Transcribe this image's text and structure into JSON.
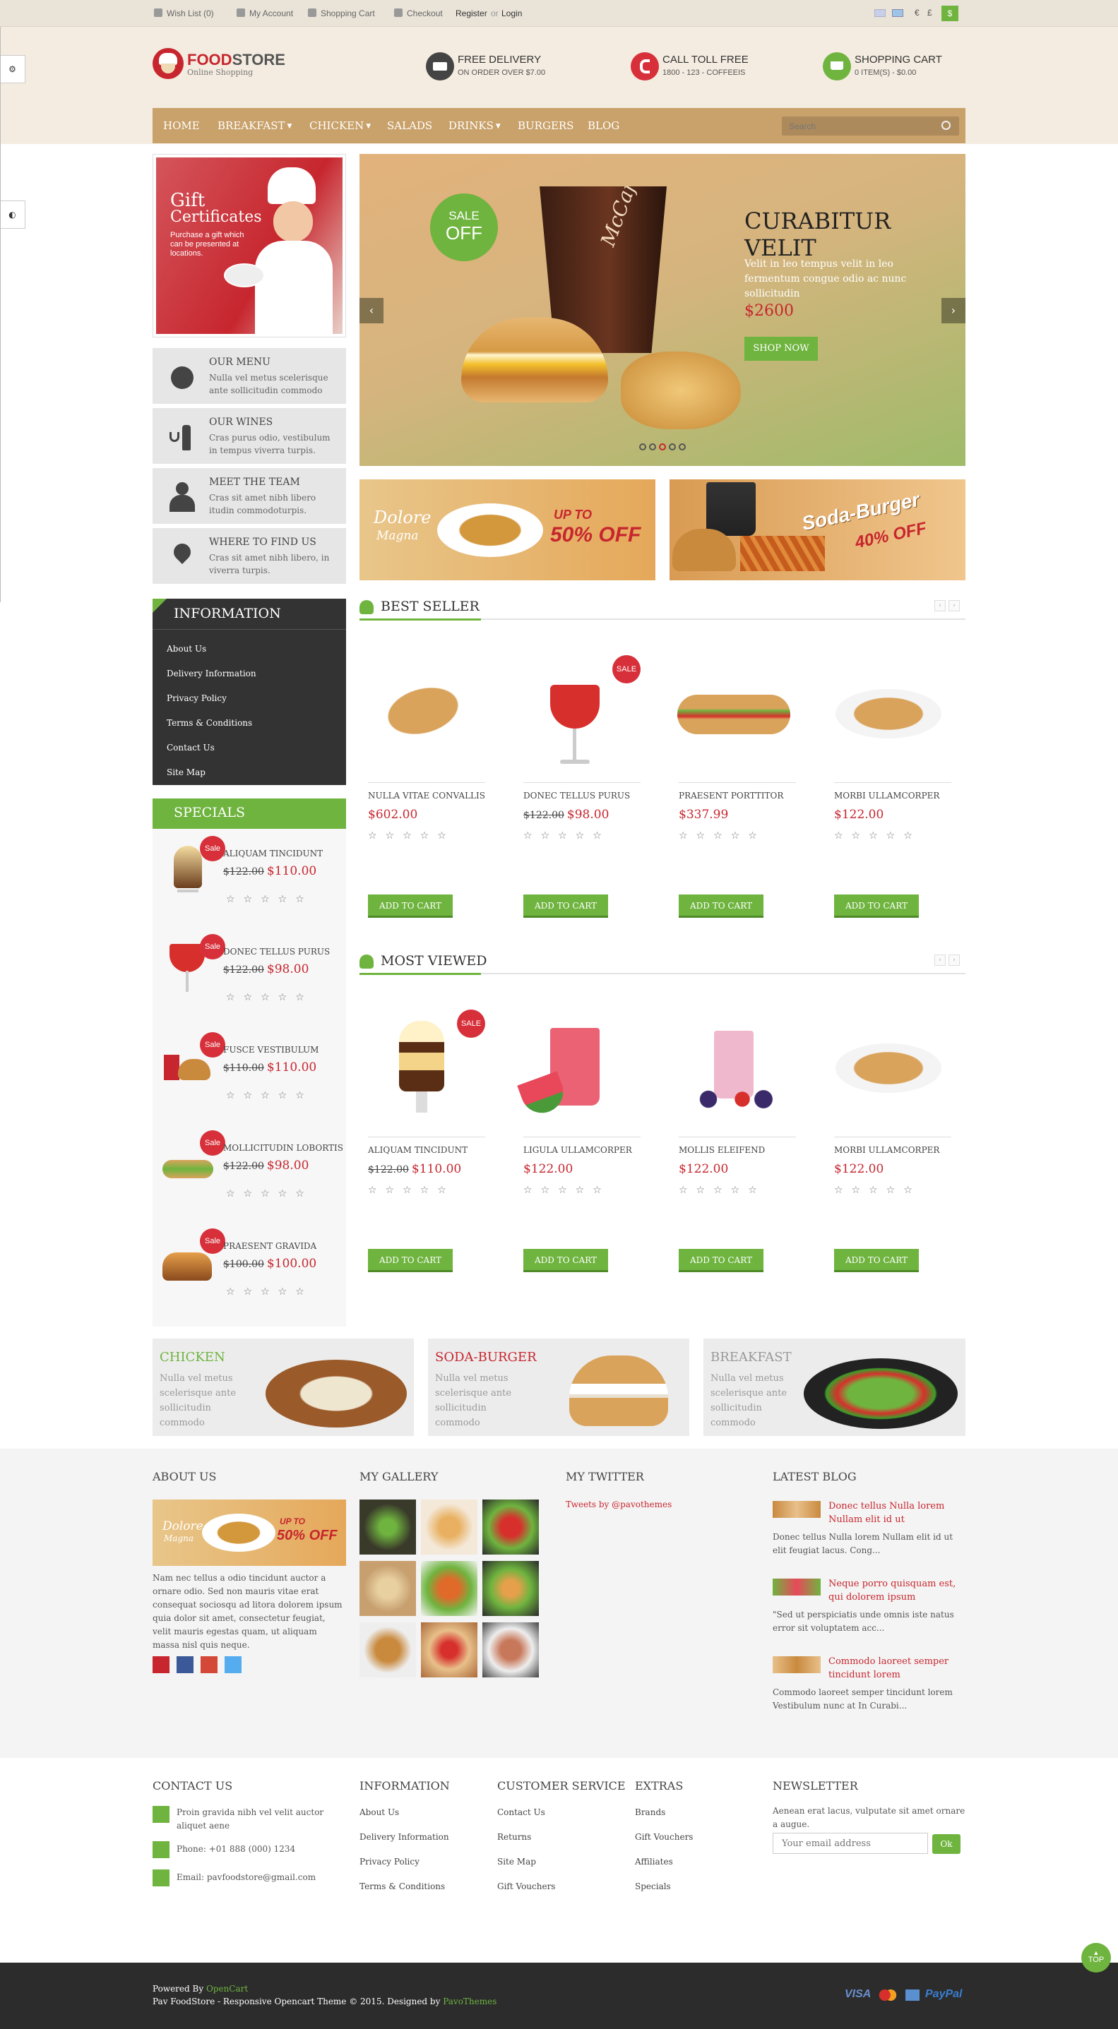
{
  "topbar": {
    "wishlist": "Wish List (0)",
    "account": "My Account",
    "cart": "Shopping Cart",
    "checkout": "Checkout",
    "register": "Register",
    "or": "or",
    "login": "Login",
    "currencies": [
      "€",
      "£",
      "$"
    ]
  },
  "logo": {
    "name_a": "FOOD",
    "name_b": "STORE",
    "tagline": "Online Shopping"
  },
  "header_info": [
    {
      "title": "FREE DELIVERY",
      "sub": "ON ORDER OVER $7.00",
      "icon": "truck-icon",
      "color": "#444444"
    },
    {
      "title": "CALL TOLL FREE",
      "sub": "1800 - 123 - COFFEEIS",
      "icon": "phone-icon",
      "color": "#d7303a"
    },
    {
      "title": "SHOPPING CART",
      "sub": "0 ITEM(S) - $0.00",
      "icon": "cart-icon",
      "color": "#6fb43f"
    }
  ],
  "nav": [
    {
      "label": "HOME",
      "dropdown": false
    },
    {
      "label": "BREAKFAST",
      "dropdown": true
    },
    {
      "label": "CHICKEN",
      "dropdown": true
    },
    {
      "label": "SALADS",
      "dropdown": false
    },
    {
      "label": "DRINKS",
      "dropdown": true
    },
    {
      "label": "BURGERS",
      "dropdown": false
    },
    {
      "label": "BLOG",
      "dropdown": false
    }
  ],
  "search": {
    "placeholder": "Search"
  },
  "gift": {
    "title1": "Gift",
    "title2": "Certificates",
    "desc": "Purchase a gift which can be presented at locations."
  },
  "features": [
    {
      "title": "OUR MENU",
      "desc": "Nulla vel metus scelerisque ante sollicitudin commodo"
    },
    {
      "title": "OUR WINES",
      "desc": "Cras purus odio, vestibulum in tempus viverra turpis."
    },
    {
      "title": "MEET THE TEAM",
      "desc": "Cras sit amet nibh libero itudin commodoturpis."
    },
    {
      "title": "WHERE TO FIND US",
      "desc": "Cras sit amet nibh libero, in viverra turpis."
    }
  ],
  "information": {
    "title": "INFORMATION",
    "links": [
      "About Us",
      "Delivery Information",
      "Privacy Policy",
      "Terms & Conditions",
      "Contact Us",
      "Site Map"
    ]
  },
  "specials": {
    "title": "SPECIALS",
    "sale_label": "Sale",
    "items": [
      {
        "name": "ALIQUAM TINCIDUNT",
        "old": "$122.00",
        "price": "$110.00"
      },
      {
        "name": "DONEC TELLUS PURUS",
        "old": "$122.00",
        "price": "$98.00"
      },
      {
        "name": "FUSCE VESTIBULUM",
        "old": "$110.00",
        "price": "$110.00"
      },
      {
        "name": "MOLLICITUDIN LOBORTIS",
        "old": "$122.00",
        "price": "$98.00"
      },
      {
        "name": "PRAESENT GRAVIDA",
        "old": "$100.00",
        "price": "$100.00"
      }
    ]
  },
  "slider": {
    "badge1": "SALE",
    "badge2": "OFF",
    "title": "CURABITUR VELIT",
    "desc": "Velit in leo tempus velit in leo fermentum congue odio ac nunc sollicitudin",
    "price": "$2600",
    "button": "SHOP NOW",
    "cup_brand": "McCafé",
    "dots": 5,
    "active_dot": 3
  },
  "promo": [
    {
      "name1": "Dolore",
      "name2": "Magna",
      "upto": "UP TO",
      "pct": "50% OFF"
    },
    {
      "name1": "Soda-Burger",
      "pct": "40% OFF"
    }
  ],
  "best_seller": {
    "title": "BEST SELLER",
    "products": [
      {
        "name": "NULLA VITAE CONVALLIS",
        "old": "",
        "price": "$602.00",
        "sale": false
      },
      {
        "name": "DONEC TELLUS PURUS",
        "old": "$122.00",
        "price": "$98.00",
        "sale": true
      },
      {
        "name": "PRAESENT PORTTITOR",
        "old": "",
        "price": "$337.99",
        "sale": false
      },
      {
        "name": "MORBI ULLAMCORPER",
        "old": "",
        "price": "$122.00",
        "sale": false
      }
    ]
  },
  "most_viewed": {
    "title": "MOST VIEWED",
    "products": [
      {
        "name": "ALIQUAM TINCIDUNT",
        "old": "$122.00",
        "price": "$110.00",
        "sale": true
      },
      {
        "name": "LIGULA ULLAMCORPER",
        "old": "",
        "price": "$122.00",
        "sale": false
      },
      {
        "name": "MOLLIS ELEIFEND",
        "old": "",
        "price": "$122.00",
        "sale": false
      },
      {
        "name": "MORBI ULLAMCORPER",
        "old": "",
        "price": "$122.00",
        "sale": false
      }
    ]
  },
  "add_to_cart": "ADD TO CART",
  "sale_label": "SALE",
  "categories": [
    {
      "title": "CHICKEN",
      "desc": "Nulla vel metus scelerisque ante sollicitudin commodo",
      "color": "#6fb43f"
    },
    {
      "title": "SODA-BURGER",
      "desc": "Nulla vel metus scelerisque ante sollicitudin commodo",
      "color": "#c7262e"
    },
    {
      "title": "BREAKFAST",
      "desc": "Nulla vel metus scelerisque ante sollicitudin commodo",
      "color": "#999999"
    }
  ],
  "footer": {
    "about_title": "ABOUT US",
    "about_text": "Nam nec tellus a odio tincidunt auctor a ornare odio. Sed non mauris vitae erat consequat sociosqu ad litora dolorem ipsum quia dolor sit amet, consectetur feugiat, velit mauris egestas quam, ut aliquam massa nisl quis neque.",
    "gallery_title": "MY GALLERY",
    "twitter_title": "MY TWITTER",
    "twitter_link": "Tweets by @pavothemes",
    "blog_title": "LATEST BLOG",
    "blog": [
      {
        "title": "Donec tellus Nulla lorem Nullam elit id ut",
        "desc": "Donec tellus Nulla lorem Nullam elit id ut elit feugiat lacus. Cong..."
      },
      {
        "title": "Neque porro quisquam est, qui dolorem ipsum",
        "desc": "\"Sed ut perspiciatis unde omnis iste natus error sit voluptatem acc..."
      },
      {
        "title": "Commodo laoreet semper tincidunt lorem",
        "desc": "Commodo laoreet semper tincidunt lorem Vestibulum nunc at In Curabi..."
      }
    ],
    "contact_title": "CONTACT US",
    "contact_address": "Proin gravida nibh vel velit auctor aliquet aene",
    "contact_phone": "Phone: +01 888 (000) 1234",
    "contact_email": "Email: pavfoodstore@gmail.com",
    "info_title": "INFORMATION",
    "info_links": [
      "About Us",
      "Delivery Information",
      "Privacy Policy",
      "Terms & Conditions"
    ],
    "cs_title": "CUSTOMER SERVICE",
    "cs_links": [
      "Contact Us",
      "Returns",
      "Site Map",
      "Gift Vouchers"
    ],
    "extras_title": "EXTRAS",
    "extras_links": [
      "Brands",
      "Gift Vouchers",
      "Affiliates",
      "Specials"
    ],
    "newsletter_title": "NEWSLETTER",
    "newsletter_text": "Aenean erat lacus, vulputate sit amet ornare a augue.",
    "newsletter_placeholder": "Your email address",
    "newsletter_btn": "Ok",
    "top_label": "TOP",
    "powered_by": "Powered By",
    "opencart": "OpenCart",
    "copyright": "Pav FoodStore - Responsive Opencart Theme © 2015. Designed by",
    "designer": "PavoThemes",
    "payments": [
      "VISA",
      "PayPal"
    ]
  },
  "colors": {
    "accent_green": "#6fb43f",
    "accent_red": "#c7262e",
    "nav_tan": "#c9a16a"
  }
}
